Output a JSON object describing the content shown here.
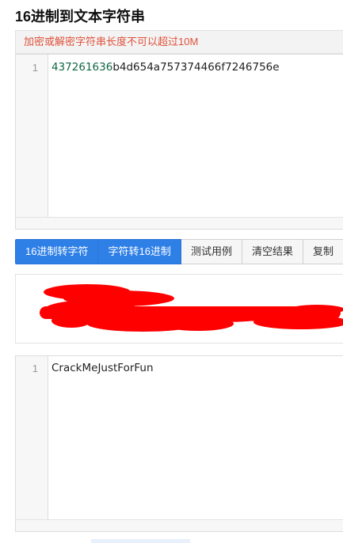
{
  "page": {
    "title": "16进制到文本字符串"
  },
  "notice": {
    "text": "加密或解密字符串长度不可以超过10M"
  },
  "input_editor": {
    "line_number": "1",
    "content_numeric": "437261636",
    "content_rest": "b4d654a757374466f7246756e"
  },
  "toolbar": {
    "buttons": [
      "16进制转字符",
      "字符转16进制",
      "测试用例",
      "清空结果",
      "复制"
    ]
  },
  "output_editor": {
    "line_number": "1",
    "content": "CrackMeJustForFun"
  },
  "colors": {
    "primary": "#2e7fe6",
    "notice": "#e0523c",
    "redaction": "#ff0000"
  }
}
